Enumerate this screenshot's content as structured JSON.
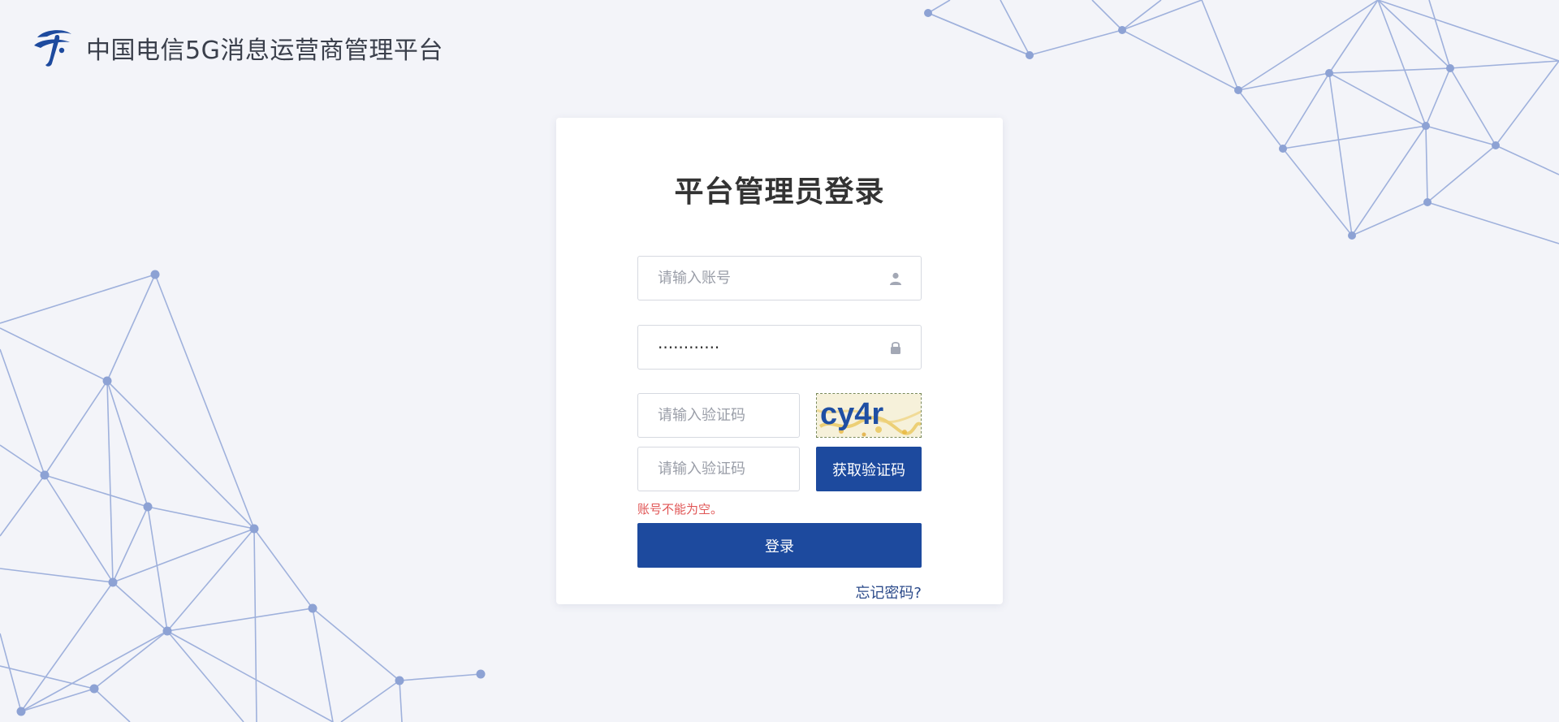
{
  "header": {
    "brand_title": "中国电信5G消息运营商管理平台"
  },
  "login": {
    "title": "平台管理员登录",
    "account_placeholder": "请输入账号",
    "account_value": "",
    "password_value": "············",
    "captcha_placeholder": "请输入验证码",
    "captcha_image_text": "cy4r",
    "sms_code_placeholder": "请输入验证码",
    "get_code_label": "获取验证码",
    "error_text": "账号不能为空。",
    "login_label": "登录",
    "forgot_label": "忘记密码?"
  },
  "icons": {
    "brand": "china-telecom-logo",
    "account": "user-icon",
    "password": "lock-icon"
  },
  "colors": {
    "primary": "#1d4a9e",
    "background": "#f3f4f9",
    "error": "#e05555",
    "link": "#2b4a8a",
    "network": "#9fb1dc"
  }
}
